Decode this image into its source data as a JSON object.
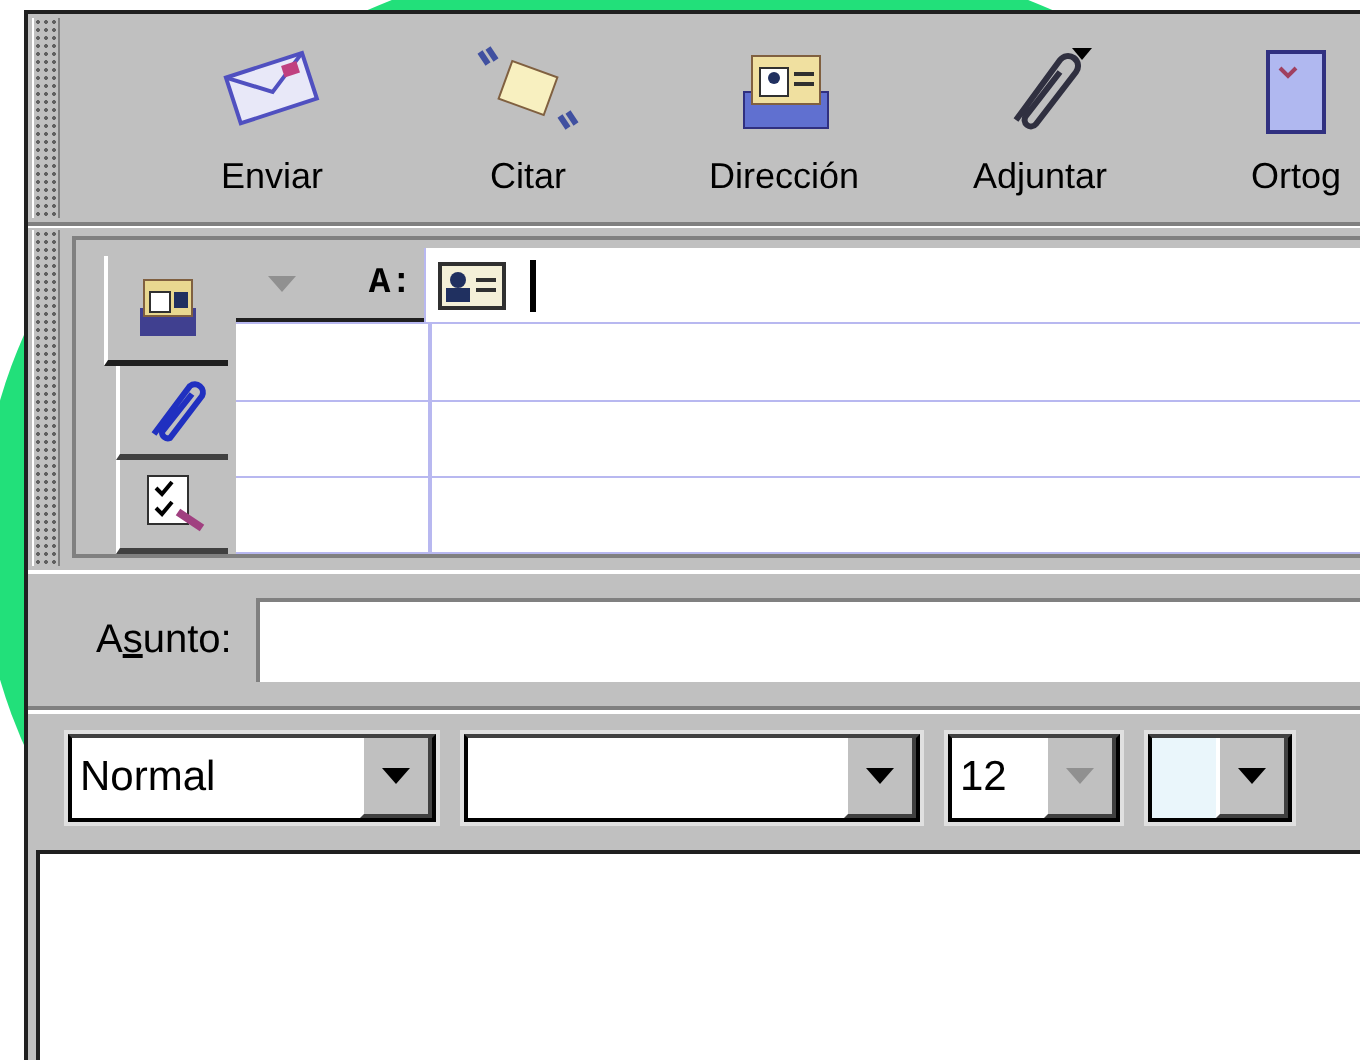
{
  "toolbar": {
    "buttons": [
      {
        "label": "Enviar",
        "kind": "send"
      },
      {
        "label": "Citar",
        "kind": "quote"
      },
      {
        "label": "Dirección",
        "kind": "address"
      },
      {
        "label": "Adjuntar",
        "kind": "attach"
      },
      {
        "label": "Ortog",
        "kind": "spell"
      }
    ]
  },
  "address_panel": {
    "tabs": [
      {
        "kind": "addressing",
        "selected": true
      },
      {
        "kind": "attachments",
        "selected": false
      },
      {
        "kind": "options",
        "selected": false
      }
    ],
    "recipient_label": "A:"
  },
  "subject": {
    "label_before": "A",
    "label_key": "s",
    "label_after": "unto:"
  },
  "format_bar": {
    "paragraph_style": "Normal",
    "size": "12",
    "size_arrow_disabled": true
  }
}
